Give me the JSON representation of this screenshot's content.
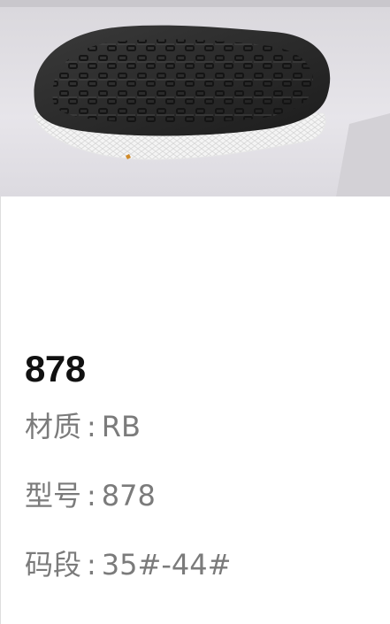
{
  "product": {
    "title": "878",
    "specs": [
      {
        "label": "材质",
        "separator": ":",
        "value": "RB"
      },
      {
        "label": "型号",
        "separator": ":",
        "value": "878"
      },
      {
        "label": "码段",
        "separator": ":",
        "value": "35#-44#"
      }
    ]
  },
  "photo": {
    "subject": "shoe-sole-photo",
    "colors": {
      "background": "#e4e2e6",
      "sole": "#2a2a2a",
      "midsole": "#f2f2f2",
      "accent": "#d08a2a"
    }
  }
}
